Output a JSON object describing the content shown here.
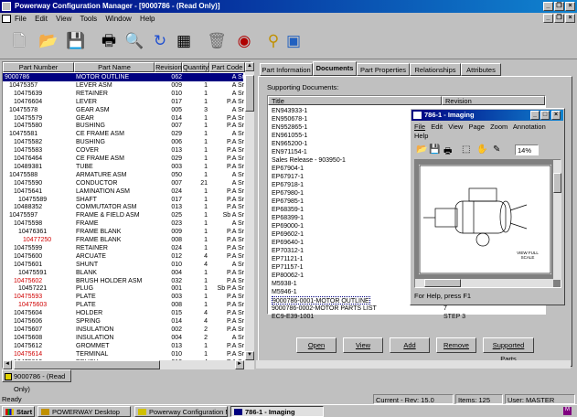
{
  "window": {
    "title": "Powerway Configuration Manager - [9000786 - (Read Only)]"
  },
  "menu": [
    "File",
    "Edit",
    "View",
    "Tools",
    "Window",
    "Help"
  ],
  "toolbar_icons": [
    "new-icon",
    "open-icon",
    "save-icon",
    "print-icon",
    "print-preview-icon",
    "refresh-icon",
    "structure-icon",
    "trash-icon",
    "archive-icon",
    "search-icon",
    "explore-icon"
  ],
  "tree": {
    "headers": [
      "Part Number",
      "Part Name",
      "Revision",
      "Quantity",
      "Part Code"
    ],
    "rows": [
      [
        "9000786",
        "MOTOR OUTLINE",
        "062",
        "",
        "A Sr"
      ],
      [
        "10475357",
        "LEVER ASM",
        "009",
        "1",
        "A Sr"
      ],
      [
        "10475639",
        "RETAINER",
        "010",
        "1",
        "A Sr"
      ],
      [
        "10476604",
        "LEVER",
        "017",
        "1",
        "P.A Sr"
      ],
      [
        "10475578",
        "GEAR ASM",
        "005",
        "3",
        "A Sr"
      ],
      [
        "10475579",
        "GEAR",
        "014",
        "1",
        "P.A Sr"
      ],
      [
        "10475580",
        "BUSHING",
        "007",
        "1",
        "P.A Sr"
      ],
      [
        "10475581",
        "CE FRAME ASM",
        "029",
        "1",
        "A Sr"
      ],
      [
        "10475582",
        "BUSHING",
        "006",
        "1",
        "P.A Sr"
      ],
      [
        "10475583",
        "COVER",
        "013",
        "1",
        "P.A Sr"
      ],
      [
        "10476464",
        "CE FRAME ASM",
        "029",
        "1",
        "P.A Sr"
      ],
      [
        "10489381",
        "TUBE",
        "003",
        "1",
        "P.A Sr"
      ],
      [
        "10475588",
        "ARMATURE ASM",
        "050",
        "1",
        "A Sr"
      ],
      [
        "10475590",
        "CONDUCTOR",
        "007",
        "21",
        "A Sr"
      ],
      [
        "10475641",
        "LAMINATION ASM",
        "024",
        "1",
        "P.A Sr"
      ],
      [
        "10475589",
        "SHAFT",
        "017",
        "1",
        "P.A Sr"
      ],
      [
        "10488352",
        "COMMUTATOR ASM",
        "013",
        "1",
        "P.A Sr"
      ],
      [
        "10475597",
        "FRAME & FIELD ASM",
        "025",
        "1",
        "Sb A Sr"
      ],
      [
        "10475598",
        "FRAME",
        "023",
        "1",
        "A Sr"
      ],
      [
        "10476361",
        "FRAME BLANK",
        "009",
        "1",
        "P.A Sr"
      ],
      [
        "10477250",
        "FRAME BLANK",
        "008",
        "1",
        "P.A Sr"
      ],
      [
        "10475599",
        "RETAINER",
        "024",
        "1",
        "P.A Sr"
      ],
      [
        "10475600",
        "ARCUATE",
        "012",
        "4",
        "P.A Sr"
      ],
      [
        "10475601",
        "SHUNT",
        "010",
        "4",
        "A Sr"
      ],
      [
        "10475591",
        "BLANK",
        "004",
        "1",
        "P.A Sr"
      ],
      [
        "10475602",
        "BRUSH HOLDER ASM",
        "032",
        "1",
        "P.A Sr"
      ],
      [
        "10457221",
        "PLUG",
        "001",
        "1",
        "Sb P.A Sr"
      ],
      [
        "10475593",
        "PLATE",
        "003",
        "1",
        "P.A Sr"
      ],
      [
        "10475603",
        "PLATE",
        "008",
        "1",
        "P.A Sr"
      ],
      [
        "10475604",
        "HOLDER",
        "015",
        "4",
        "P.A Sr"
      ],
      [
        "10475606",
        "SPRING",
        "014",
        "4",
        "P.A Sr"
      ],
      [
        "10475607",
        "INSULATION",
        "002",
        "2",
        "P.A Sr"
      ],
      [
        "10475608",
        "INSULATION",
        "004",
        "2",
        "A Sr"
      ],
      [
        "10475612",
        "GROMMET",
        "013",
        "1",
        "P.A Sr"
      ],
      [
        "10475614",
        "TERMINAL",
        "010",
        "1",
        "P.A Sr"
      ],
      [
        "10475610",
        "BRUSH",
        "012",
        "4",
        "P.A Sr"
      ]
    ]
  },
  "left_tab": "9000786 - (Read Only)",
  "tabs": [
    "Part Information",
    "Documents",
    "Part Properties",
    "Relationships",
    "Attributes"
  ],
  "documents": {
    "label": "Supporting Documents:",
    "headers": [
      "Title",
      "Revision"
    ],
    "rows": [
      [
        "EN943933-1",
        "0"
      ],
      [
        "EN950678-1",
        ""
      ],
      [
        "EN952865-1",
        ""
      ],
      [
        "EN961055-1",
        ""
      ],
      [
        "EN965200-1",
        ""
      ],
      [
        "EN971154-1",
        ""
      ],
      [
        "Sales Release - 903950-1",
        ""
      ],
      [
        "EP67904-1",
        ""
      ],
      [
        "EP67917-1",
        ""
      ],
      [
        "EP67918-1",
        ""
      ],
      [
        "EP67980-1",
        ""
      ],
      [
        "EP67985-1",
        ""
      ],
      [
        "EP68359-1",
        ""
      ],
      [
        "EP68399-1",
        ""
      ],
      [
        "EP69000-1",
        ""
      ],
      [
        "EP69602-1",
        ""
      ],
      [
        "EP69640-1",
        ""
      ],
      [
        "EP70312-1",
        ""
      ],
      [
        "EP71121-1",
        ""
      ],
      [
        "EP71157-1",
        ""
      ],
      [
        "EP80062-1",
        ""
      ],
      [
        "M5938-1",
        ""
      ],
      [
        "M5946-1",
        "0"
      ],
      [
        "9000786-0001-MOTOR OUTLINE",
        "62"
      ],
      [
        "9000786-0002-MOTOR PARTS LIST",
        "7"
      ],
      [
        "EC9-E39-1001",
        "STEP 3"
      ]
    ],
    "buttons": [
      "Open",
      "View",
      "Add",
      "Remove",
      "Supported Parts"
    ]
  },
  "imaging": {
    "title": "786-1 - Imaging",
    "menu": [
      "File",
      "Edit",
      "View",
      "Page",
      "Zoom",
      "Annotation",
      "Help"
    ],
    "zoom": "14%",
    "drawing_caption": "VIEW FULL SCALE",
    "status": "For Help, press F1"
  },
  "status": {
    "left": "Ready",
    "rev": "Current - Rev: 15.0",
    "items": "Items: 125",
    "user": "User: MASTER"
  },
  "taskbar": [
    "Start",
    "POWERWAY Desktop",
    "Powerway Configuration M...",
    "786-1 - Imaging"
  ],
  "colors": {
    "title_start": "#000080",
    "title_end": "#1084d0",
    "selection": "#000080",
    "changed_text": "#d00000"
  }
}
